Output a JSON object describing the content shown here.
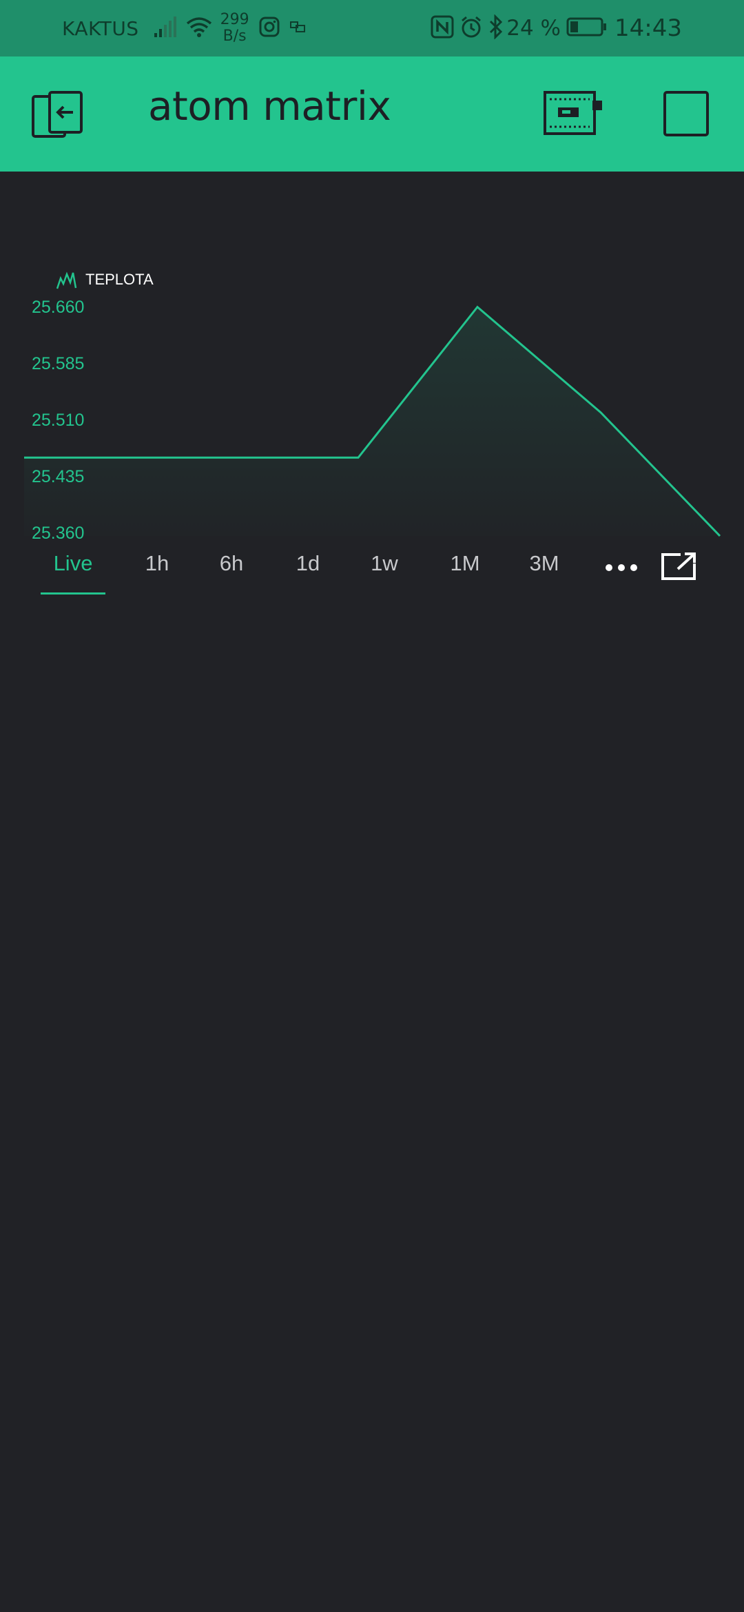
{
  "status_bar": {
    "carrier": "KAKTUS",
    "speed_value": "299",
    "speed_unit": "B/s",
    "battery_percent": "24 %",
    "time": "14:43"
  },
  "app_bar": {
    "title": "atom matrix",
    "icons": [
      "exit-icon",
      "device-icon",
      "play-stop-icon"
    ]
  },
  "chart": {
    "legend": "TEPLOTA",
    "y_ticks": [
      "25.660",
      "25.585",
      "25.510",
      "25.435",
      "25.360"
    ],
    "line_color": "#23c48e"
  },
  "chart_data": {
    "type": "area",
    "series": [
      {
        "name": "TEPLOTA",
        "values": [
          25.464,
          25.464,
          25.464,
          25.464,
          25.664,
          25.524,
          25.36
        ]
      }
    ],
    "ylim": [
      25.36,
      25.66
    ],
    "title": "",
    "xlabel": "",
    "ylabel": ""
  },
  "time_ranges": {
    "tabs": [
      "Live",
      "1h",
      "6h",
      "1d",
      "1w",
      "1M",
      "3M"
    ],
    "active": "Live"
  },
  "colors": {
    "accent": "#23c48e",
    "status_bar_bg": "#1f8f6a",
    "background": "#212226"
  }
}
